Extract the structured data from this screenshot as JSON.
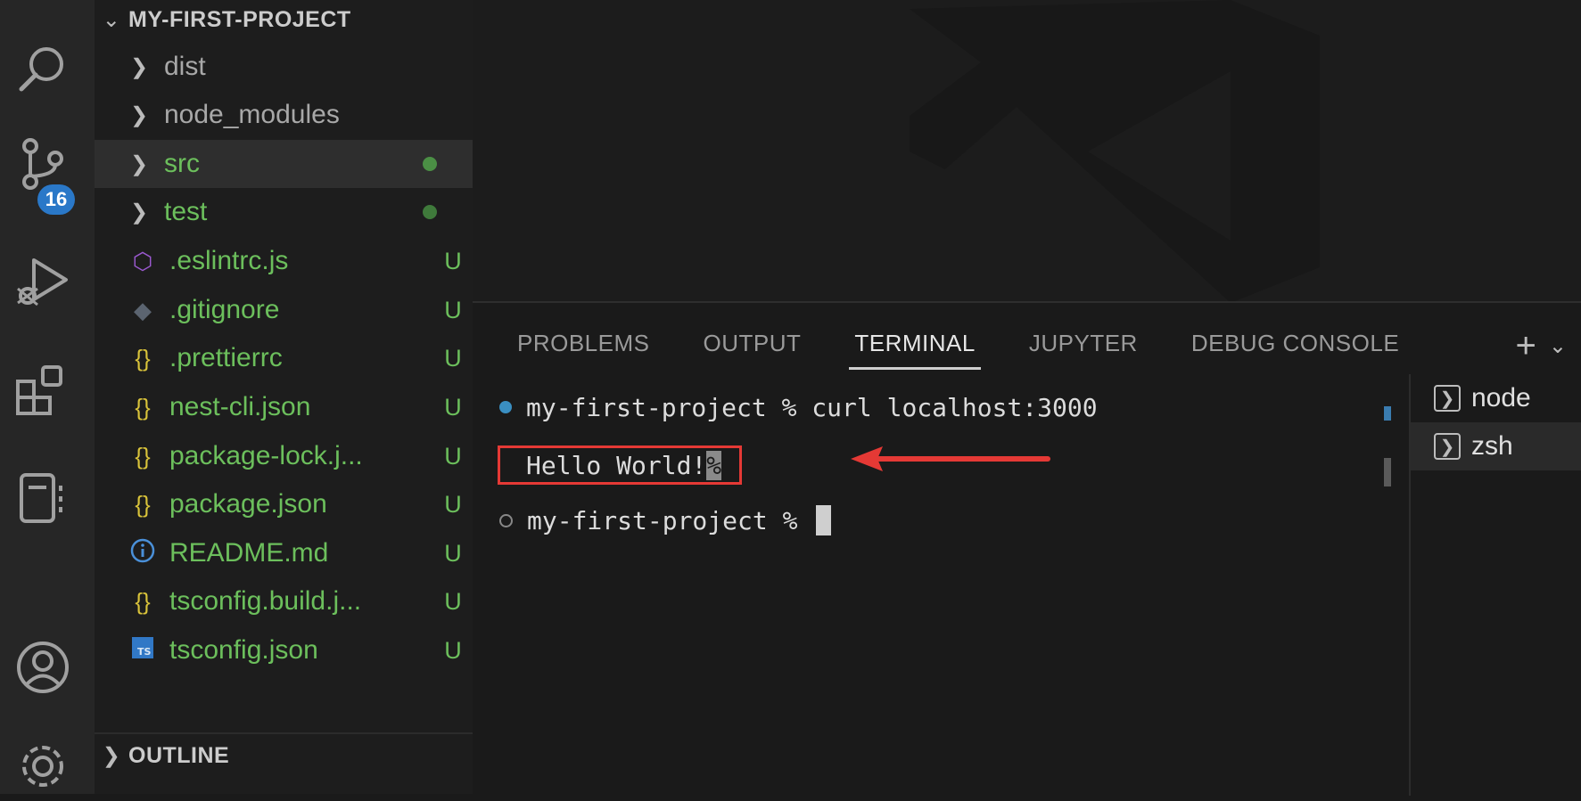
{
  "activity_bar": {
    "icons": [
      "search-icon",
      "source-control-icon",
      "run-debug-icon",
      "extensions-icon",
      "notebook-icon",
      "account-icon",
      "settings-gear-icon"
    ],
    "source_control_badge": "16"
  },
  "explorer": {
    "project_title": "MY-FIRST-PROJECT",
    "folders": [
      {
        "label": "dist"
      },
      {
        "label": "node_modules"
      },
      {
        "label": "src"
      },
      {
        "label": "test"
      }
    ],
    "files": [
      {
        "label": ".eslintrc.js",
        "status": "U",
        "icon": "eslint-icon"
      },
      {
        "label": ".gitignore",
        "status": "U",
        "icon": "git-icon"
      },
      {
        "label": ".prettierrc",
        "status": "U",
        "icon": "json-braces-icon"
      },
      {
        "label": "nest-cli.json",
        "status": "U",
        "icon": "json-braces-icon"
      },
      {
        "label": "package-lock.j...",
        "status": "U",
        "icon": "json-braces-icon"
      },
      {
        "label": "package.json",
        "status": "U",
        "icon": "json-braces-icon"
      },
      {
        "label": "README.md",
        "status": "U",
        "icon": "info-icon"
      },
      {
        "label": "tsconfig.build.j...",
        "status": "U",
        "icon": "json-braces-icon"
      },
      {
        "label": "tsconfig.json",
        "status": "U",
        "icon": "typescript-icon"
      }
    ],
    "json_icon_glyph": "{}",
    "outline_title": "OUTLINE"
  },
  "panel": {
    "tabs": [
      "PROBLEMS",
      "OUTPUT",
      "TERMINAL",
      "JUPYTER",
      "DEBUG CONSOLE"
    ],
    "active_tab": "TERMINAL",
    "new_terminal_glyph": "+",
    "dropdown_glyph": "⌄"
  },
  "terminal": {
    "line1_prompt": "my-first-project %",
    "line1_command": " curl localhost:3000",
    "output_text": "Hello World!",
    "output_marker": "%",
    "line3_prompt": "my-first-project % "
  },
  "terminal_list": [
    {
      "label": "node"
    },
    {
      "label": "zsh"
    }
  ],
  "colors": {
    "accent": "#2a78c8",
    "untracked_green": "#5cb85c",
    "highlight_red": "#e53935",
    "json_icon_yellow": "#d9c33a"
  }
}
